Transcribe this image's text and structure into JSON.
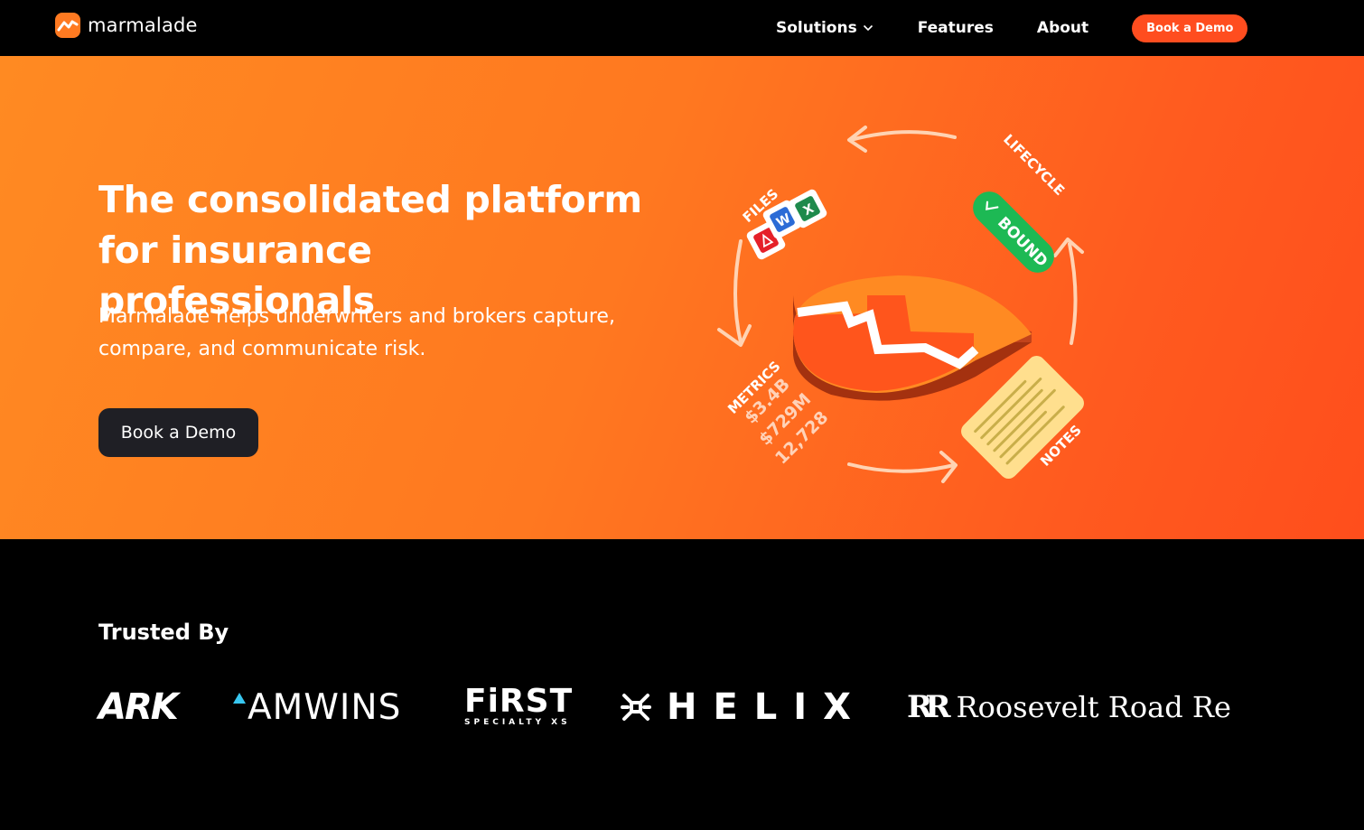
{
  "nav": {
    "brand": "marmalade",
    "links": {
      "solutions": "Solutions",
      "features": "Features",
      "about": "About"
    },
    "cta": "Book a Demo"
  },
  "hero": {
    "title_line1": "The consolidated platform",
    "title_line2": "for insurance professionals",
    "subtitle_line1": "Marmalade helps underwriters and brokers capture,",
    "subtitle_line2": "compare, and communicate risk.",
    "cta": "Book a Demo",
    "illustration": {
      "files_label": "FILES",
      "lifecycle_label": "LIFECYCLE",
      "bound_label": "BOUND",
      "metrics_label": "METRICS",
      "metric_1": "$3.4B",
      "metric_2": "$729M",
      "metric_3": "12,728",
      "notes_label": "NOTES",
      "file_icons": [
        "pdf-icon",
        "word-icon",
        "excel-icon"
      ]
    }
  },
  "trusted": {
    "title": "Trusted By",
    "logos": {
      "ark": "ARK",
      "amwins": "AMWINS",
      "first_big": "FiRST",
      "first_small": "SPECIALTY XS",
      "helix": "HELIX",
      "rr_mark": "RR",
      "rr_word": "Roosevelt Road Re"
    }
  },
  "colors": {
    "accent": "#ff4d1f",
    "hero_start": "#ff8a22",
    "hero_end": "#ff4e1c",
    "dark_button": "#1f1f25",
    "bound_green": "#1db954"
  }
}
